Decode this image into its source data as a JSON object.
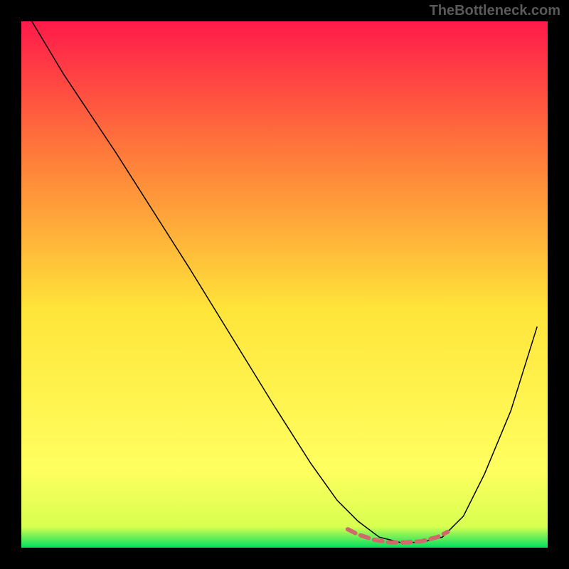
{
  "watermark": "TheBottleneck.com",
  "chart_data": {
    "type": "line",
    "title": "",
    "xlabel": "",
    "ylabel": "",
    "xlim": [
      0,
      100
    ],
    "ylim": [
      0,
      100
    ],
    "background_gradient": {
      "top": "#ff1a4a",
      "mid1": "#ff7a3a",
      "mid2": "#ffe53a",
      "mid3": "#ffff60",
      "bottom": "#00e060"
    },
    "series": [
      {
        "name": "curve",
        "color": "#000000",
        "stroke_width": 1.5,
        "x": [
          2,
          5,
          8,
          12,
          18,
          25,
          32,
          40,
          48,
          55,
          60,
          64,
          68,
          72,
          76,
          80,
          84,
          88,
          93,
          98
        ],
        "y": [
          100,
          95,
          90,
          84,
          75,
          64,
          53,
          40,
          27,
          16,
          9,
          5,
          2,
          1,
          1,
          2,
          6,
          14,
          26,
          42
        ]
      },
      {
        "name": "highlight",
        "color": "#d06a6a",
        "stroke_width": 6,
        "x": [
          62,
          64,
          67,
          70,
          73,
          76,
          79,
          81
        ],
        "y": [
          3.5,
          2.5,
          1.5,
          1,
          1,
          1.2,
          2,
          3
        ]
      }
    ]
  }
}
